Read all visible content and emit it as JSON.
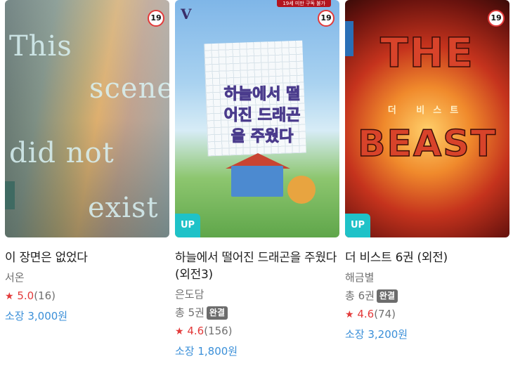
{
  "books": [
    {
      "title": "이 장면은 없었다",
      "author": "서온",
      "volumes": null,
      "complete_label": null,
      "rating": "5.0",
      "rating_count": "(16)",
      "price": "소장 3,000원",
      "age_badge": "19",
      "up_badge": null,
      "cover_text": "This scene did not exist"
    },
    {
      "title": "하늘에서 떨어진 드래곤을 주웠다 (외전3)",
      "author": "은도담",
      "volumes": "총 5권",
      "complete_label": "완결",
      "rating": "4.6",
      "rating_count": "(156)",
      "price": "소장 1,800원",
      "age_badge": "19",
      "up_badge": "UP",
      "top_strip": "19세 미만 구독 불가",
      "cover_text": "하늘에서 떨어진 드래곤을 주웠다",
      "logo_text": "V"
    },
    {
      "title": "더 비스트 6권 (외전)",
      "author": "해금별",
      "volumes": "총 6권",
      "complete_label": "완결",
      "rating": "4.6",
      "rating_count": "(74)",
      "price": "소장 3,200원",
      "age_badge": "19",
      "up_badge": "UP",
      "cover_text_1": "THE",
      "cover_text_2": "BEAST",
      "cover_subtitle": "더 비스트"
    }
  ],
  "colors": {
    "star": "#e33a3a",
    "price": "#3a8fd8",
    "up_badge": "#1fc2c8",
    "complete_badge": "#6c6c6c"
  },
  "icons": [
    "star-icon"
  ]
}
